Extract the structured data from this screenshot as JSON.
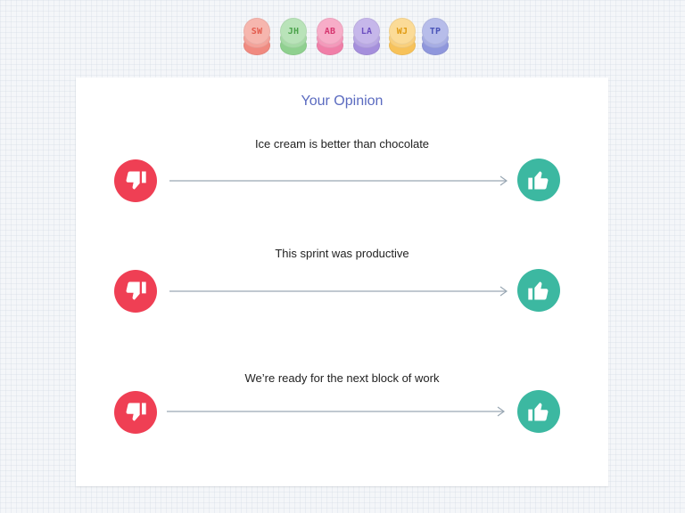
{
  "participants": [
    {
      "initials": "SW",
      "color": "#f08a80",
      "text_color": "#e35a4d"
    },
    {
      "initials": "JH",
      "color": "#8fd08f",
      "text_color": "#4aa24a"
    },
    {
      "initials": "AB",
      "color": "#f07fa8",
      "text_color": "#d6356f"
    },
    {
      "initials": "LA",
      "color": "#a58fdc",
      "text_color": "#6c4fc0"
    },
    {
      "initials": "WJ",
      "color": "#f7c25a",
      "text_color": "#e09a10"
    },
    {
      "initials": "TP",
      "color": "#8f97dc",
      "text_color": "#4b55b8"
    }
  ],
  "card": {
    "title": "Your Opinion"
  },
  "statements": [
    {
      "text": "Ice cream is better than chocolate",
      "disagree_icon": "thumbs-down-icon",
      "agree_icon": "thumbs-up-icon"
    },
    {
      "text": "This sprint was productive",
      "disagree_icon": "thumbs-down-icon",
      "agree_icon": "thumbs-up-icon"
    },
    {
      "text": "We’re ready for the next block of work",
      "disagree_icon": "thumbs-down-icon",
      "agree_icon": "thumbs-up-icon"
    }
  ],
  "colors": {
    "disagree": "#ef3f54",
    "agree": "#3cb8a1",
    "title": "#5b6bc0",
    "scale_line": "#9aa8b4"
  }
}
